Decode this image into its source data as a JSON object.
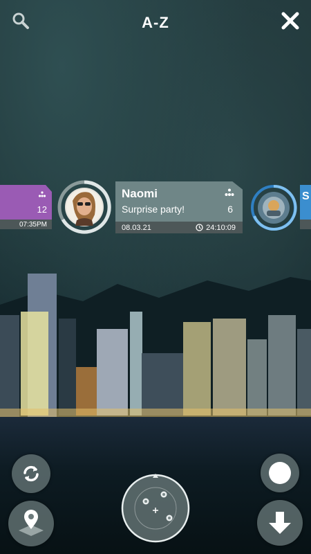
{
  "header": {
    "title": "A-Z",
    "search_icon": "search-icon",
    "close_icon": "close-icon"
  },
  "stories": {
    "left": {
      "count": "12",
      "time": "07:35PM",
      "color": "#9a5bb4"
    },
    "main": {
      "name": "Naomi",
      "message": "Surprise party!",
      "count": "6",
      "date": "08.03.21",
      "duration": "24:10:09",
      "color": "#6f8687"
    },
    "right": {
      "initial": "S",
      "color": "#3b8ecf"
    }
  },
  "controls": {
    "refresh_icon": "refresh-icon",
    "location_icon": "location-pin-icon",
    "record_icon": "record-icon",
    "download_icon": "arrow-down-icon",
    "joystick": "joystick-control"
  }
}
